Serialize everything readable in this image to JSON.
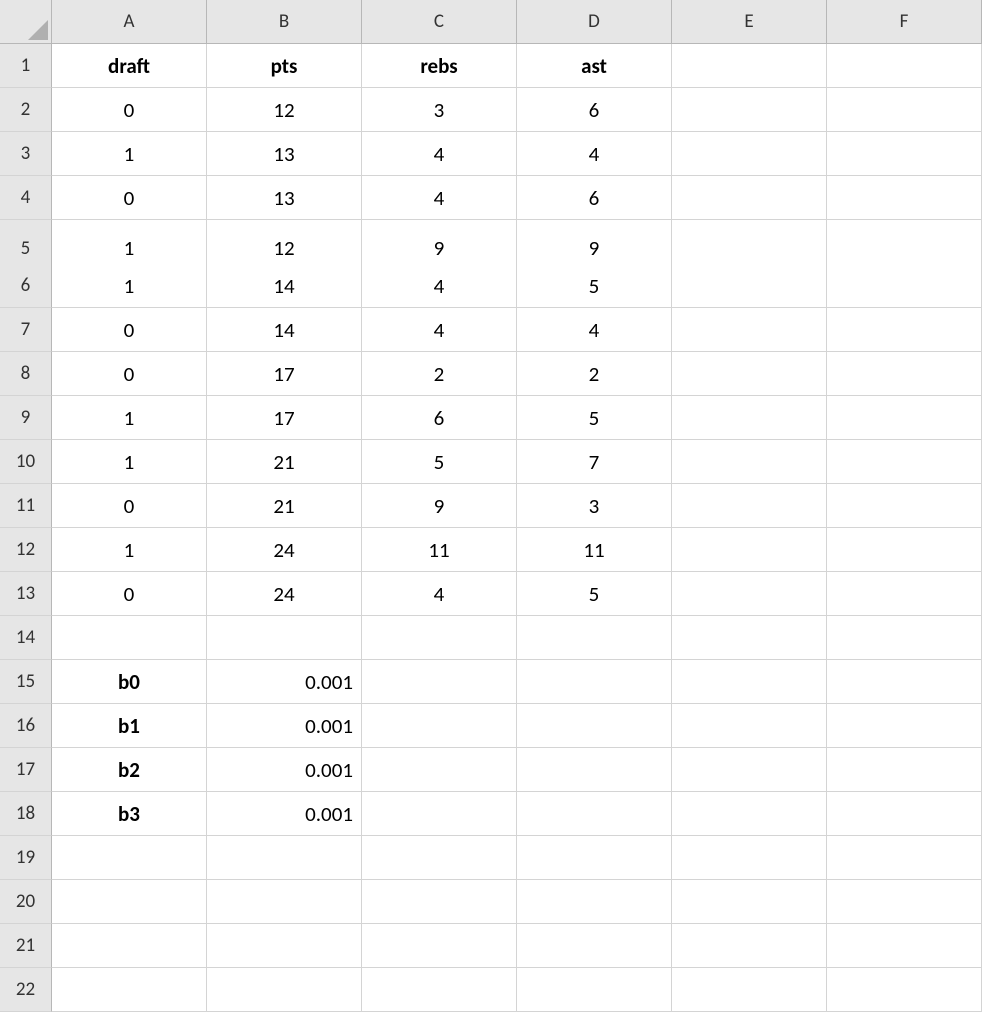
{
  "columns": [
    "A",
    "B",
    "C",
    "D",
    "E",
    "F"
  ],
  "row_count": 22,
  "headers_row": {
    "A": "draft",
    "B": "pts",
    "C": "rebs",
    "D": "ast"
  },
  "data_rows": [
    {
      "A": "0",
      "B": "12",
      "C": "3",
      "D": "6"
    },
    {
      "A": "1",
      "B": "13",
      "C": "4",
      "D": "4"
    },
    {
      "A": "0",
      "B": "13",
      "C": "4",
      "D": "6"
    },
    {
      "A": "1",
      "B": "12",
      "C": "9",
      "D": "9"
    },
    {
      "A": "1",
      "B": "14",
      "C": "4",
      "D": "5"
    },
    {
      "A": "0",
      "B": "14",
      "C": "4",
      "D": "4"
    },
    {
      "A": "0",
      "B": "17",
      "C": "2",
      "D": "2"
    },
    {
      "A": "1",
      "B": "17",
      "C": "6",
      "D": "5"
    },
    {
      "A": "1",
      "B": "21",
      "C": "5",
      "D": "7"
    },
    {
      "A": "0",
      "B": "21",
      "C": "9",
      "D": "3"
    },
    {
      "A": "1",
      "B": "24",
      "C": "11",
      "D": "11"
    },
    {
      "A": "0",
      "B": "24",
      "C": "4",
      "D": "5"
    }
  ],
  "coef_rows": [
    {
      "A": "b0",
      "B": "0.001"
    },
    {
      "A": "b1",
      "B": "0.001"
    },
    {
      "A": "b2",
      "B": "0.001"
    },
    {
      "A": "b3",
      "B": "0.001"
    }
  ]
}
